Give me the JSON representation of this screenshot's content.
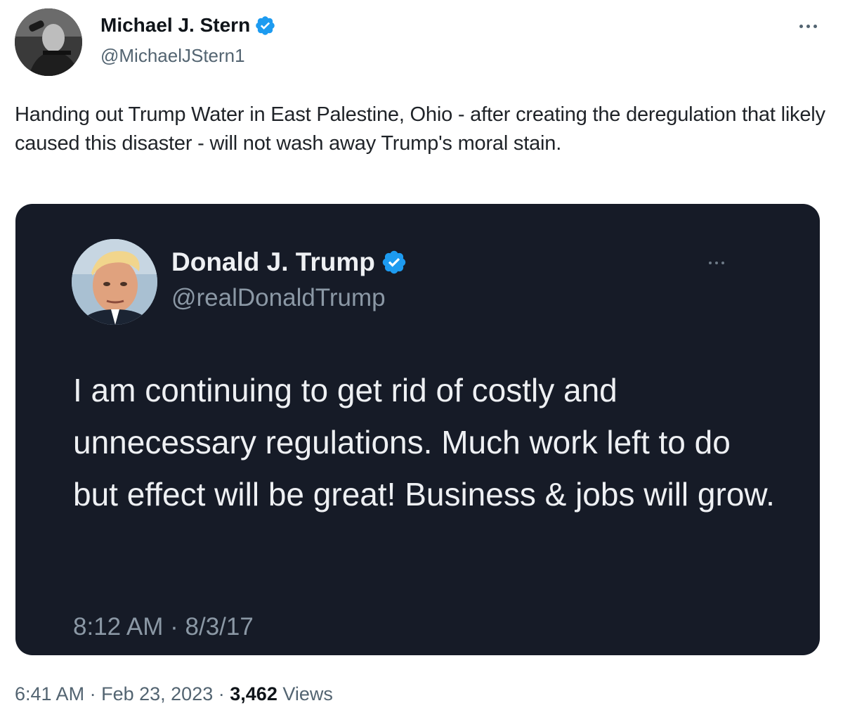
{
  "tweet": {
    "author": {
      "name": "Michael J. Stern",
      "handle": "@MichaelJStern1",
      "verified": true
    },
    "text": "Handing out Trump Water in East Palestine, Ohio - after creating the deregulation that likely caused this disaster - will not wash away Trump's moral stain.",
    "timestamp": "6:41 AM",
    "date": "Feb 23, 2023",
    "separator": "·",
    "views_count": "3,462",
    "views_label": "Views"
  },
  "quoted_image": {
    "author": {
      "name": "Donald J. Trump",
      "handle": "@realDonaldTrump",
      "verified": true
    },
    "text": "I am continuing to get rid of costly and unnecessary regulations. Much work left to do but effect will be great! Business & jobs will grow.",
    "timestamp": "8:12 AM · 8/3/17",
    "background_color": "#161b27"
  },
  "colors": {
    "verified_badge": "#1d9bf0",
    "secondary_text": "#536471",
    "primary_text": "#0f1419"
  },
  "icons": {
    "verified": "verified-badge-icon",
    "more": "more-options-icon"
  }
}
